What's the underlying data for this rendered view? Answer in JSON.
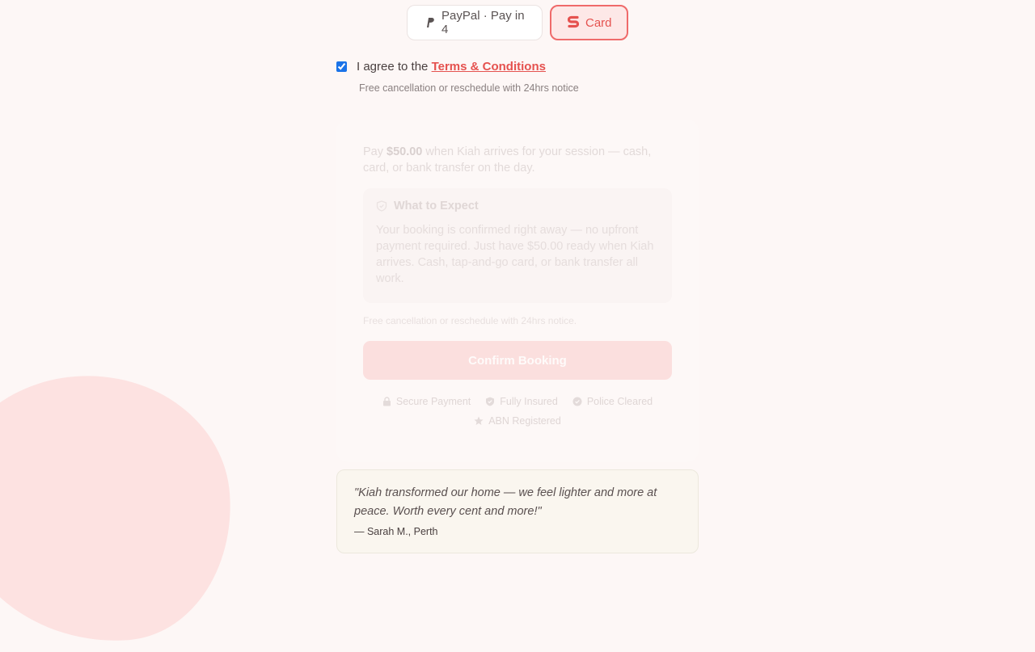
{
  "payment_tabs": [
    {
      "label": "PayPal · Pay in 4",
      "icon": "paypal-icon"
    },
    {
      "label": "Card",
      "icon": "card-brand-icon",
      "selected": true
    }
  ],
  "agreement": {
    "prefix": "I agree to the ",
    "link": "Terms & Conditions",
    "checked": true,
    "notice": "Free cancellation or reschedule with 24hrs notice"
  },
  "payment_card": {
    "pay_prefix": "Pay ",
    "amount": "$50.00",
    "pay_suffix": " when Kiah arrives for your session — cash, card, or bank transfer on the day.",
    "expect_title": "What to Expect",
    "expect_icon": "shield-icon",
    "expect_body": "Your booking is confirmed right away — no upfront payment required. Just have $50.00 ready when Kiah arrives. Cash, tap-and-go card, or bank transfer all work.",
    "notice": "Free cancellation or reschedule with 24hrs notice.",
    "confirm_label": "Confirm Booking",
    "badges": [
      {
        "label": "Secure Payment",
        "icon": "lock-icon"
      },
      {
        "label": "Fully Insured",
        "icon": "shield-check-icon"
      },
      {
        "label": "Police Cleared",
        "icon": "check-circle-icon"
      },
      {
        "label": "ABN Registered",
        "icon": "star-icon"
      }
    ]
  },
  "testimonial": {
    "quote": "\"Kiah transformed our home — we feel lighter and more at peace. Worth every cent and more!\"",
    "author": "— Sarah M., Perth"
  },
  "colors": {
    "accent": "#e5524f",
    "accent_soft": "#fde8e7",
    "background": "#fdf7f6",
    "blob": "#fde2e1"
  }
}
